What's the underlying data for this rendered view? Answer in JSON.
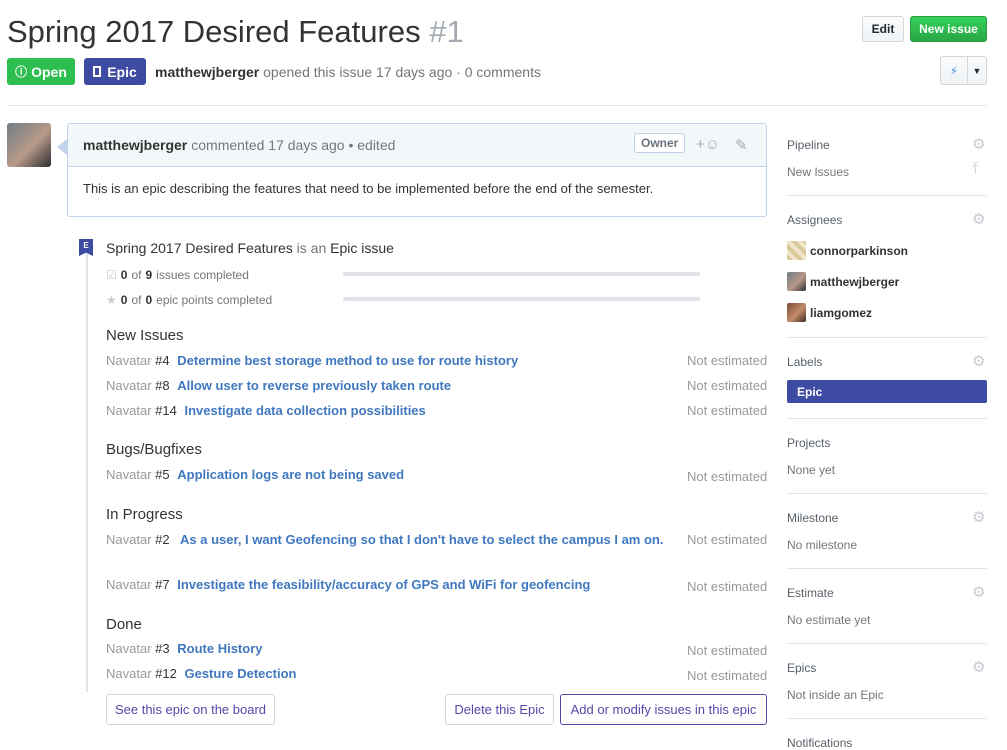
{
  "header": {
    "title": "Spring 2017 Desired Features",
    "number": "#1",
    "edit_label": "Edit",
    "new_issue_label": "New issue",
    "state_label": "Open",
    "epic_badge": "Epic",
    "author": "matthewjberger",
    "meta_text": "opened this issue 17 days ago · 0 comments"
  },
  "comment": {
    "author": "matthewjberger",
    "meta": "commented 17 days ago • edited",
    "owner_badge": "Owner",
    "body": "This is an epic describing the features that need to be implemented before the end of the semester."
  },
  "epic": {
    "title": "Spring 2017 Desired Features",
    "is_an": "is an",
    "type": "Epic issue",
    "issues_done": "0",
    "of_1": "of",
    "issues_total": "9",
    "issues_label": "issues completed",
    "points_done": "0",
    "of_2": "of",
    "points_total": "0",
    "points_label": "epic points completed",
    "issues_progress": 0,
    "points_progress": 0
  },
  "sections": [
    {
      "name": "New Issues",
      "issues": [
        {
          "repo": "Navatar",
          "num": "#4",
          "title": "Determine best storage method to use for route history",
          "est": "Not estimated"
        },
        {
          "repo": "Navatar",
          "num": "#8",
          "title": "Allow user to reverse previously taken route",
          "est": "Not estimated"
        },
        {
          "repo": "Navatar",
          "num": "#14",
          "title": "Investigate data collection possibilities",
          "est": "Not estimated"
        }
      ]
    },
    {
      "name": "Bugs/Bugfixes",
      "issues": [
        {
          "repo": "Navatar",
          "num": "#5",
          "title": "Application logs are not being saved",
          "est": "Not estimated"
        }
      ]
    },
    {
      "name": "In Progress",
      "issues": [
        {
          "repo": "Navatar",
          "num": "#2",
          "title": "As a user, I want Geofencing so that I don't have to select the campus I am on.",
          "est": "Not estimated"
        },
        {
          "repo": "Navatar",
          "num": "#7",
          "title": "Investigate the feasibility/accuracy of GPS and WiFi for geofencing",
          "est": "Not estimated"
        }
      ]
    },
    {
      "name": "Done",
      "issues": [
        {
          "repo": "Navatar",
          "num": "#3",
          "title": "Route History",
          "est": "Not estimated"
        },
        {
          "repo": "Navatar",
          "num": "#12",
          "title": "Gesture Detection",
          "est": "Not estimated"
        }
      ]
    }
  ],
  "footer": {
    "board_btn": "See this epic on the board",
    "delete_btn": "Delete this Epic",
    "modify_btn": "Add or modify issues in this epic"
  },
  "sidebar": {
    "pipeline_title": "Pipeline",
    "pipeline_value": "New Issues",
    "assignees_title": "Assignees",
    "assignees": [
      "connorparkinson",
      "matthewjberger",
      "liamgomez"
    ],
    "labels_title": "Labels",
    "label": "Epic",
    "projects_title": "Projects",
    "projects_value": "None yet",
    "milestone_title": "Milestone",
    "milestone_value": "No milestone",
    "estimate_title": "Estimate",
    "estimate_value": "No estimate yet",
    "epics_title": "Epics",
    "epics_value": "Not inside an Epic",
    "notifications_title": "Notifications"
  },
  "colors": {
    "open_green": "#2cbe4e",
    "epic_purple": "#3e4ba3",
    "link_blue": "#4078c0"
  }
}
